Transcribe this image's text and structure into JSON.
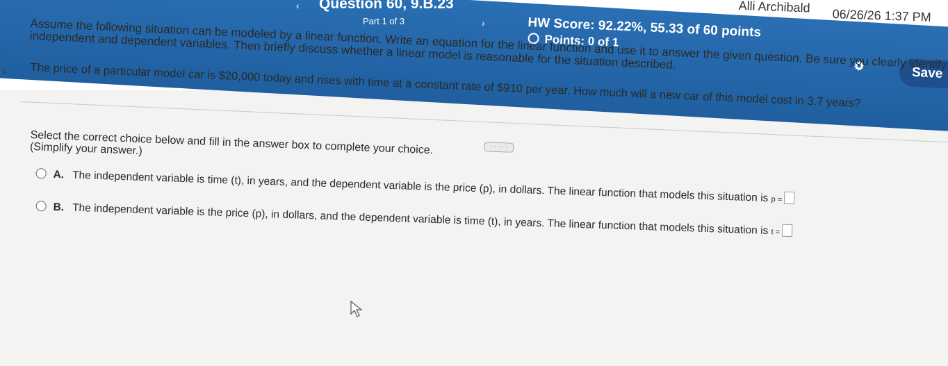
{
  "header": {
    "question_title": "Question 60, 9.B.23",
    "part": "Part 1 of 3",
    "hw_score": "HW Score: 92.22%, 55.33 of 60 points",
    "points": "Points: 0 of 1",
    "user_name": "Alli Archibald",
    "datetime": "06/26/26 1:37 PM",
    "save_label": "Save",
    "icons": {
      "prev": "chevron-left-icon",
      "next": "chevron-right-icon",
      "settings": "gear-icon"
    },
    "colors": {
      "band": "#1f5f9f",
      "save": "#1d4f8c"
    }
  },
  "content": {
    "instructions_line1": "Assume the following situation can be modeled by a linear function. Write an equation for the linear function and use it to answer the given question. Be sure you clearly identify the",
    "instructions_line2": "independent and dependent variables. Then briefly discuss whether a linear model is reasonable for the situation described.",
    "problem": "The price of a particular model car is $20,000 today and rises with time at a constant rate of $910 per year. How much will a new car of this model cost in 3.7 years?",
    "more_label": "· · · · ·",
    "select_line1": "Select the correct choice below and fill in the answer box to complete your choice.",
    "select_line2": "(Simplify your answer.)",
    "choices": [
      {
        "letter": "A.",
        "text": "The independent variable is time (t), in years, and the dependent variable is the price (p), in dollars. The linear function that models this situation is",
        "equation": "p ="
      },
      {
        "letter": "B.",
        "text": "The independent variable is the price (p), in dollars, and the dependent variable is time (t), in years. The linear function that models this situation is",
        "equation": "t ="
      }
    ]
  }
}
